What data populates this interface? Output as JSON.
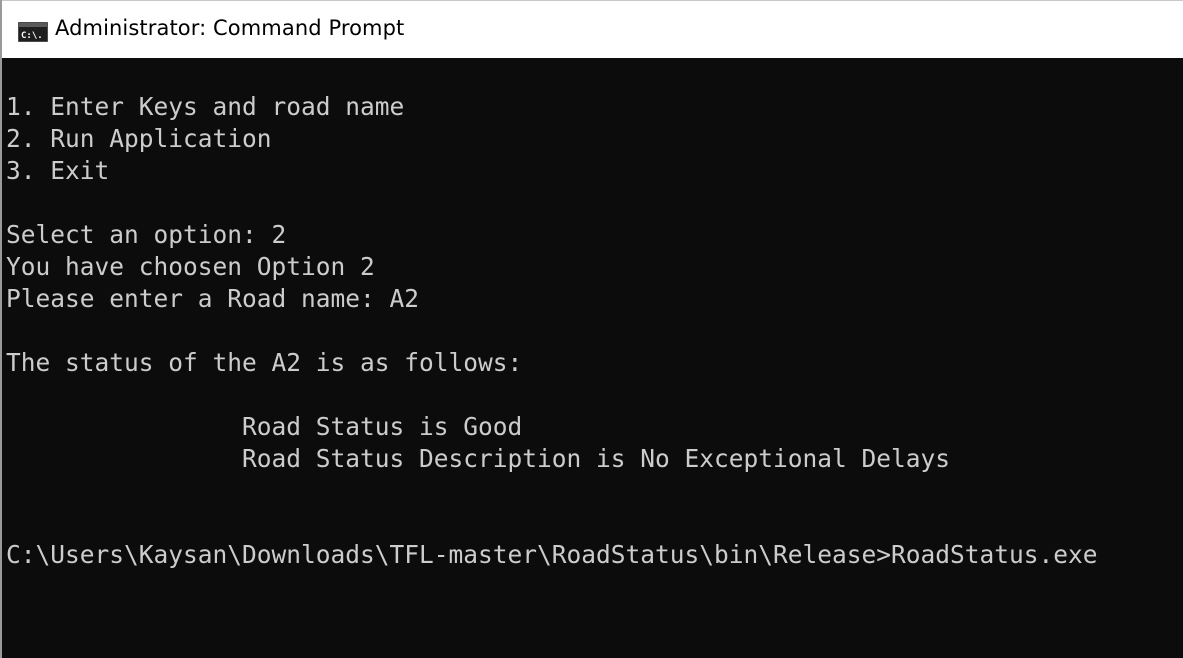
{
  "window": {
    "title": "Administrator: Command Prompt",
    "icon": "command-prompt-icon",
    "icon_text": "C:\\."
  },
  "console": {
    "menu": [
      "1. Enter Keys and road name",
      "2. Run Application",
      "3. Exit"
    ],
    "select_prompt": "Select an option: 2",
    "chosen_message": "You have choosen Option 2",
    "road_prompt": "Please enter a Road name: A2",
    "status_header": "The status of the A2 is as follows:",
    "road_status": "                Road Status is Good",
    "road_status_description": "                Road Status Description is No Exceptional Delays",
    "command_line": "C:\\Users\\Kaysan\\Downloads\\TFL-master\\RoadStatus\\bin\\Release>RoadStatus.exe"
  },
  "colors": {
    "console_background": "#0c0c0c",
    "console_text": "#cccccc",
    "titlebar_background": "#ffffff"
  }
}
